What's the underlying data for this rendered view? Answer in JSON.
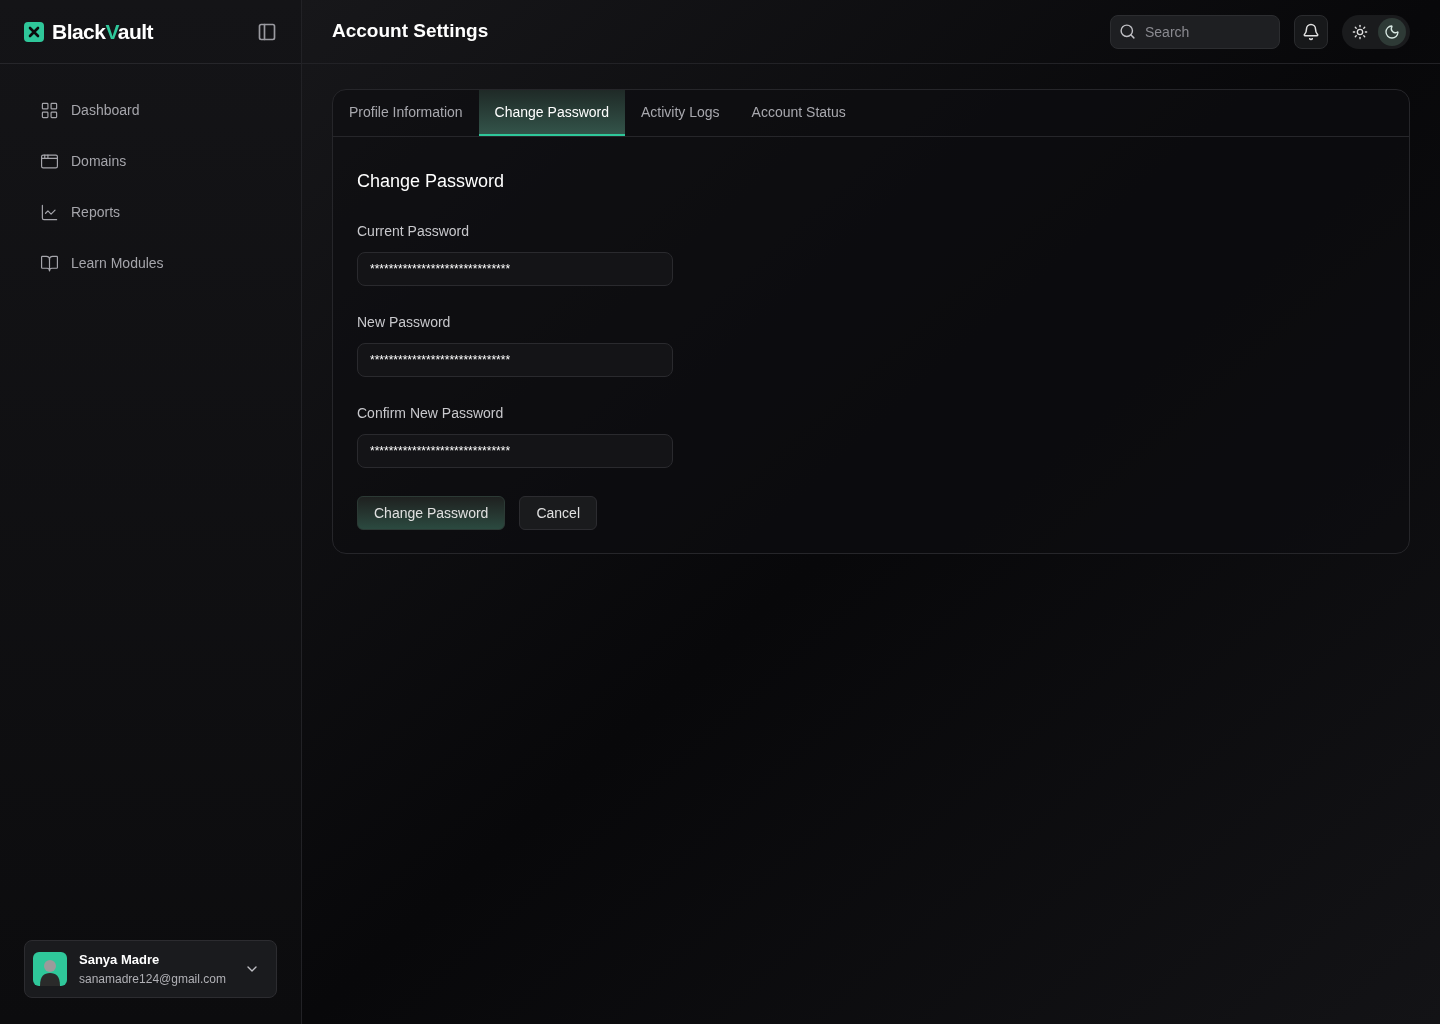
{
  "logo": {
    "parts": [
      {
        "text": "Black",
        "accent": false
      },
      {
        "text": "V",
        "accent": true
      },
      {
        "text": "ault",
        "accent": false
      }
    ]
  },
  "sidebar": {
    "items": [
      {
        "label": "Dashboard",
        "kind": "grid"
      },
      {
        "label": "Domains",
        "kind": "browser"
      },
      {
        "label": "Reports",
        "kind": "chart"
      },
      {
        "label": "Learn Modules",
        "kind": "book"
      }
    ]
  },
  "user": {
    "name": "Sanya Madre",
    "email": "sanamadre124@gmail.com"
  },
  "header": {
    "title": "Account Settings",
    "search": {
      "placeholder": "Search"
    },
    "theme_toggle": [
      {
        "kind": "light",
        "selected": false
      },
      {
        "kind": "dark",
        "selected": true
      }
    ]
  },
  "tabs": [
    {
      "label": "Profile Information",
      "selected": false
    },
    {
      "label": "Change Password",
      "selected": true
    },
    {
      "label": "Activity Logs",
      "selected": false
    },
    {
      "label": "Account Status",
      "selected": false
    }
  ],
  "form": {
    "title": "Change Password",
    "fields": [
      {
        "label": "Current Password",
        "value": "******************************"
      },
      {
        "label": "New Password",
        "value": "******************************"
      },
      {
        "label": "Confirm New Password",
        "value": "******************************"
      }
    ],
    "buttons": [
      {
        "label": "Change Password",
        "kind": "primary"
      },
      {
        "label": "Cancel",
        "kind": "secondary"
      }
    ]
  }
}
